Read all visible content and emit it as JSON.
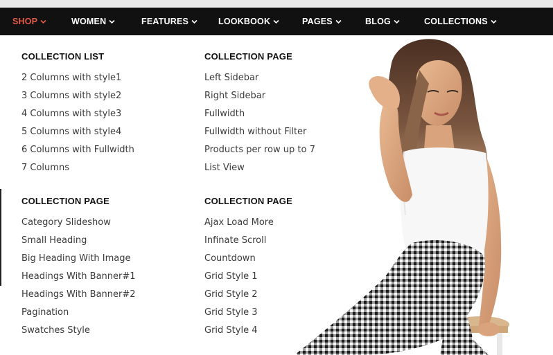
{
  "nav": {
    "items": [
      {
        "label": "SHOP",
        "active": true
      },
      {
        "label": "WOMEN",
        "active": false
      },
      {
        "label": "FEATURES",
        "active": false
      },
      {
        "label": "LOOKBOOK",
        "active": false
      },
      {
        "label": "PAGES",
        "active": false
      },
      {
        "label": "BLOG",
        "active": false
      },
      {
        "label": "COLLECTIONS",
        "active": false
      }
    ],
    "active_color": "#e75a47",
    "bar_color": "#111111"
  },
  "menu": {
    "col1_top": {
      "title": "COLLECTION LIST",
      "links": [
        "2 Columns with style1",
        "3 Columns with style2",
        "4 Columns with style3",
        "5 Columns with style4",
        "6 Columns with Fullwidth",
        "7 Columns"
      ]
    },
    "col2_top": {
      "title": "COLLECTION PAGE",
      "links": [
        "Left Sidebar",
        "Right Sidebar",
        "Fullwidth",
        "Fullwidth without Filter",
        "Products per row up to 7",
        "List View"
      ]
    },
    "col1_bottom": {
      "title": "COLLECTION PAGE",
      "links": [
        "Category Slideshow",
        "Small Heading",
        "Big Heading With Image",
        "Headings With Banner#1",
        "Headings With Banner#2",
        "Pagination",
        "Swatches Style"
      ]
    },
    "col2_bottom": {
      "title": "COLLECTION PAGE",
      "links": [
        "Ajax Load More",
        "Infinate Scroll",
        "Countdown",
        "Grid Style 1",
        "Grid Style 2",
        "Grid Style 3",
        "Grid Style 4"
      ]
    }
  },
  "banner": {
    "image": "promo-model-photo"
  }
}
